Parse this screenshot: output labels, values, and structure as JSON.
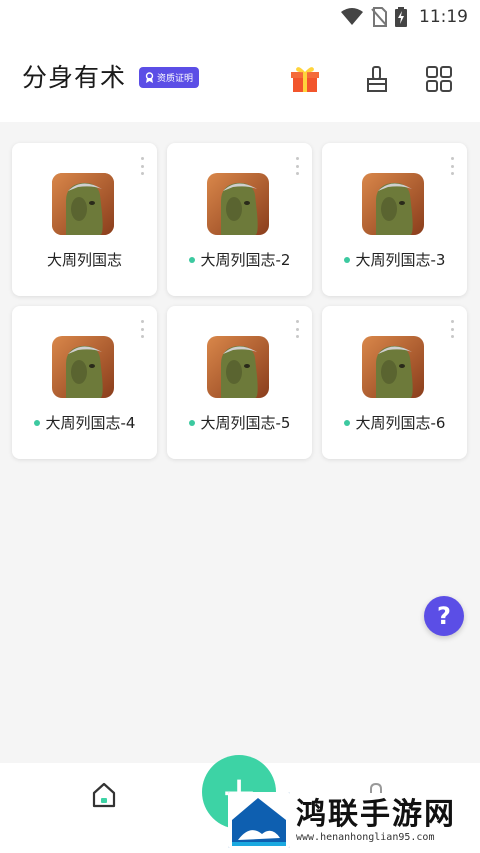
{
  "status_bar": {
    "time": "11:19"
  },
  "header": {
    "title": "分身有术",
    "badge": "资质证明"
  },
  "apps": [
    {
      "name": "大周列国志",
      "has_dot": false
    },
    {
      "name": "大周列国志-2",
      "has_dot": true
    },
    {
      "name": "大周列国志-3",
      "has_dot": true
    },
    {
      "name": "大周列国志-4",
      "has_dot": true
    },
    {
      "name": "大周列国志-5",
      "has_dot": true
    },
    {
      "name": "大周列国志-6",
      "has_dot": true
    }
  ],
  "help_button": "?",
  "fab": "+",
  "watermark": {
    "title": "鸿联手游网",
    "url": "www.henanhonglian95.com"
  },
  "colors": {
    "accent_purple": "#5b4ee6",
    "accent_green": "#3dd3a5",
    "gift_red": "#f2552c"
  }
}
